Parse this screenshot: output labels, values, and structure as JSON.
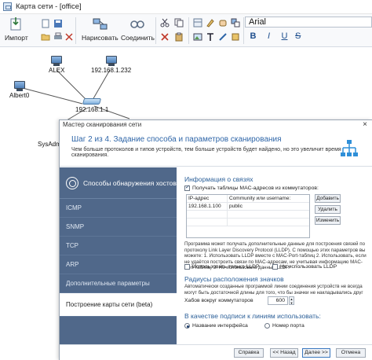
{
  "app": {
    "title": "Карта сети - [office]"
  },
  "ribbon": {
    "import_label": "Импорт",
    "draw_label": "Нарисовать",
    "connect_label": "Соединить",
    "font_name": "Arial",
    "bold": "B",
    "italic": "I",
    "underline": "U",
    "strike": "S"
  },
  "map": {
    "nodes": [
      {
        "label": "ALEX"
      },
      {
        "label": "192.168.1.232"
      },
      {
        "label": "Albert0"
      },
      {
        "label": "192.168.1.1"
      },
      {
        "label": "SysAdm"
      }
    ]
  },
  "wizard": {
    "window_title": "Мастер сканирования сети",
    "close": "×",
    "step_title": "Шаг 2 из 4. Задание способа и параметров сканирования",
    "step_desc": "Чем больше протоколов и типов устройств, тем больше устройств будет найдено, но это увеличит время сканирования.",
    "sidebar": {
      "header": "Способы обнаружения хостов",
      "items": [
        "ICMP",
        "SNMP",
        "TCP",
        "ARP",
        "Дополнительные параметры",
        "Построение карты сети (beta)"
      ]
    },
    "links_section": {
      "title": "Информация о связях",
      "mac_checkbox": "Получать таблицы MAC-адресов из коммутаторов:",
      "col_ip": "IP-адрес",
      "col_community": "Community или username:",
      "rows": [
        {
          "ip": "192.168.1.100",
          "community": "public"
        }
      ],
      "add": "Добавить",
      "delete": "Удалить",
      "edit": "Изменить",
      "lldp_text": "Программа может получать дополнительные данные для построения связей по протоколу Link Layer Discovery Protocol (LLDP). С помощью этих параметров вы можете: 1. Использовать LLDP вместе с MAC-Port-таблиц 2. Использовать, если не удаётся построить связи по MAC-адресам, не учитывая информацию MAC-Port-таблиц. 3. Не использовать данные LLDP.",
      "use_lldp": "Использовать только LLDP",
      "no_lldp": "Не использовать LLDP"
    },
    "radius_section": {
      "title": "Радиусы расположения значков",
      "text": "Автоматически созданные программой линии соединения устройств не всегда могут быть достаточной длины для того, что бы значки не накладывались друг на друга. Чтобы получить на карте достаточно много, а программе это не удаётся, рекомендуется вручную задать оптимальные радиусы расположения значков и пересоздать карту сети.",
      "hub_label": "Хабов вокруг коммутаторов",
      "hub_value": "600"
    },
    "caption_section": {
      "title": "В качестве подписи к линиям использовать:",
      "opt_interface": "Название интерфейса",
      "opt_port": "Номер порта"
    },
    "footer": {
      "help": "Справка",
      "back": "<< Назад",
      "next": "Далее >>",
      "cancel": "Отмена"
    }
  },
  "colors": {
    "sidebar_bg": "#50688a",
    "accent": "#2f66a8"
  }
}
